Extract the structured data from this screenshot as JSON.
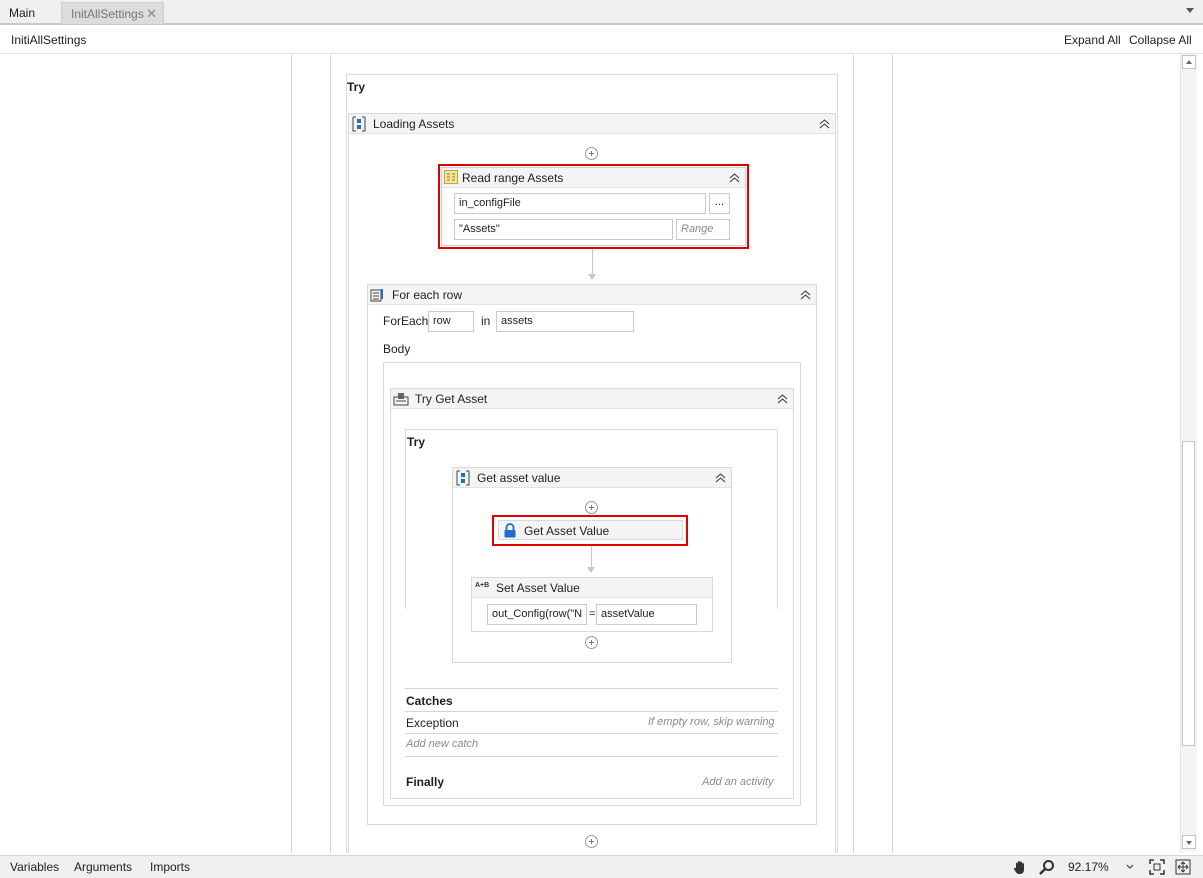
{
  "tabs": [
    {
      "label": "Main",
      "active": true
    },
    {
      "label": "InitAllSettings",
      "active": false,
      "close": "✕"
    }
  ],
  "breadcrumb": "InitiAllSettings",
  "toolbar": {
    "expand_all": "Expand All",
    "collapse_all": "Collapse All"
  },
  "workflow": {
    "try_label": "Try",
    "loading_assets": {
      "title": "Loading Assets",
      "icon": "sequence-icon",
      "read_range": {
        "title": "Read range Assets",
        "workbook_value": "in_configFile",
        "browse_label": "...",
        "sheet_value": "\"Assets\"",
        "range_placeholder": "Range"
      },
      "for_each": {
        "title": "For each row",
        "foreach_label": "ForEach",
        "item_value": "row",
        "in_label": "in",
        "collection_value": "assets",
        "body_label": "Body",
        "try_get_asset": {
          "title": "Try Get Asset",
          "try_label": "Try",
          "get_asset_value_seq": {
            "title": "Get asset value",
            "get_asset": {
              "title": "Get Asset Value"
            },
            "set_asset": {
              "title": "Set Asset Value",
              "icon_text": "A+B",
              "left_value": "out_Config(row(\"N",
              "equals": "=",
              "right_value": "assetValue"
            }
          },
          "catches_label": "Catches",
          "exception_label": "Exception",
          "exception_hint": "If empty row, skip warning",
          "add_catch": "Add new catch",
          "finally_label": "Finally",
          "finally_hint": "Add an activity"
        }
      }
    }
  },
  "bottom": {
    "variables": "Variables",
    "arguments": "Arguments",
    "imports": "Imports",
    "zoom": "92.17%"
  },
  "colors": {
    "highlight": "#e00000",
    "accent": "#1c6fc4"
  }
}
